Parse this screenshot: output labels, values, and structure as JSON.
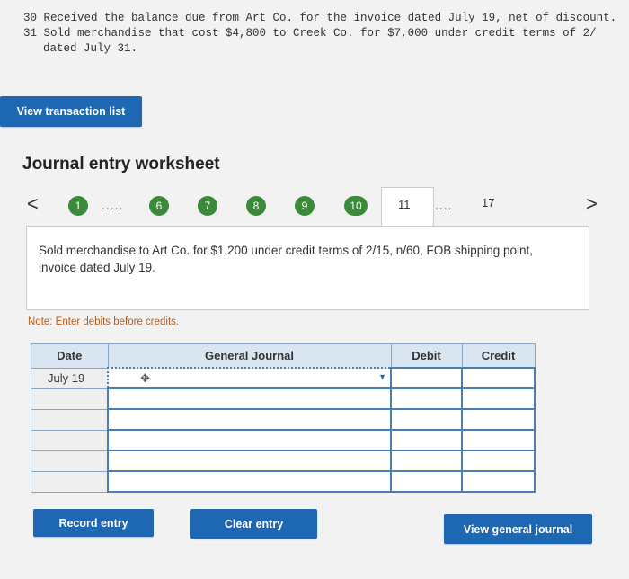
{
  "problem_text": {
    "line1": "30 Received the balance due from Art Co. for the invoice dated July 19, net of discount.",
    "line2": "31 Sold merchandise that cost $4,800 to Creek Co. for $7,000 under credit terms of 2/",
    "line3": "dated July 31."
  },
  "buttons": {
    "view_transaction_list": "View transaction list",
    "record_entry": "Record entry",
    "clear_entry": "Clear entry",
    "view_general_journal": "View general journal"
  },
  "worksheet": {
    "title": "Journal entry worksheet",
    "prev_arrow": "<",
    "next_arrow": ">",
    "steps": [
      "1",
      "6",
      "7",
      "8",
      "9",
      "10"
    ],
    "active_step": "11",
    "last_step": "17",
    "dots": ".....",
    "dots2": "....",
    "description": "Sold merchandise to Art Co. for $1,200 under credit terms of 2/15, n/60, FOB shipping point, invoice dated July 19.",
    "note": "Note: Enter debits before credits."
  },
  "journal": {
    "headers": {
      "date": "Date",
      "general_journal": "General Journal",
      "debit": "Debit",
      "credit": "Credit"
    },
    "rows": [
      {
        "date": "July 19",
        "account": "",
        "debit": "",
        "credit": ""
      },
      {
        "date": "",
        "account": "",
        "debit": "",
        "credit": ""
      },
      {
        "date": "",
        "account": "",
        "debit": "",
        "credit": ""
      },
      {
        "date": "",
        "account": "",
        "debit": "",
        "credit": ""
      },
      {
        "date": "",
        "account": "",
        "debit": "",
        "credit": ""
      },
      {
        "date": "",
        "account": "",
        "debit": "",
        "credit": ""
      }
    ]
  },
  "colors": {
    "primary_button": "#1e67b3",
    "step_done": "#3a8a3a",
    "note": "#c05a14",
    "header_bg": "#d9e6f2"
  }
}
